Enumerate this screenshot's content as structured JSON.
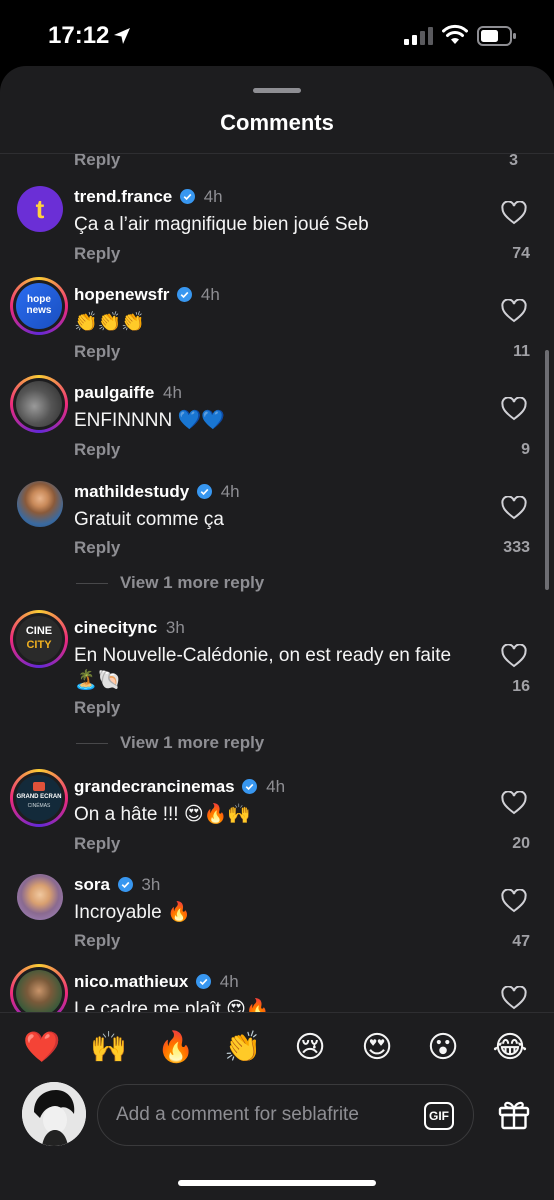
{
  "status_bar": {
    "time": "17:12"
  },
  "sheet": {
    "title": "Comments"
  },
  "partial_row": {
    "reply_label": "Reply",
    "like_count": "3"
  },
  "comments": [
    {
      "username": "trend.france",
      "verified": true,
      "time": "4h",
      "text": "Ça a l’air magnifique bien joué Seb",
      "reply_label": "Reply",
      "like_count": "74"
    },
    {
      "username": "hopenewsfr",
      "verified": true,
      "time": "4h",
      "text": "👏👏👏",
      "reply_label": "Reply",
      "like_count": "11"
    },
    {
      "username": "paulgaiffe",
      "verified": false,
      "time": "4h",
      "text": "ENFINNNN 💙💙",
      "reply_label": "Reply",
      "like_count": "9"
    },
    {
      "username": "mathildestudy",
      "verified": true,
      "time": "4h",
      "text": "Gratuit comme ça",
      "reply_label": "Reply",
      "like_count": "333",
      "view_more": "View 1 more reply"
    },
    {
      "username": "cinecitync",
      "verified": false,
      "time": "3h",
      "text": "En Nouvelle-Calédonie, on est ready en faite 🏝️🐚",
      "reply_label": "Reply",
      "like_count": "16",
      "view_more": "View 1 more reply"
    },
    {
      "username": "grandecrancinemas",
      "verified": true,
      "time": "4h",
      "text": "On a hâte !!! 😍🔥🙌",
      "reply_label": "Reply",
      "like_count": "20"
    },
    {
      "username": "sora",
      "verified": true,
      "time": "3h",
      "text": "Incroyable 🔥",
      "reply_label": "Reply",
      "like_count": "47"
    },
    {
      "username": "nico.mathieux",
      "verified": true,
      "time": "4h",
      "text": "Le cadre me plaît 😍🔥"
    }
  ],
  "avatars": {
    "trend_france": {
      "label": "t"
    },
    "hopenewsfr": {
      "line1": "hope",
      "line2": "news"
    },
    "cinecitync": {
      "line1": "CINE",
      "line2": "CITY"
    },
    "grandecrancinemas": {
      "line1": "GRAND ECRAN",
      "line2": "CINÉMAS"
    }
  },
  "emoji_bar": [
    "❤️",
    "🙌",
    "🔥",
    "👏",
    "😢",
    "😍",
    "😮",
    "😂"
  ],
  "composer": {
    "placeholder": "Add a comment for seblafrite",
    "gif_label": "GIF"
  },
  "colors": {
    "background": "#1d1d1f",
    "verified": "#3897f0",
    "muted": "#8e8e93"
  }
}
